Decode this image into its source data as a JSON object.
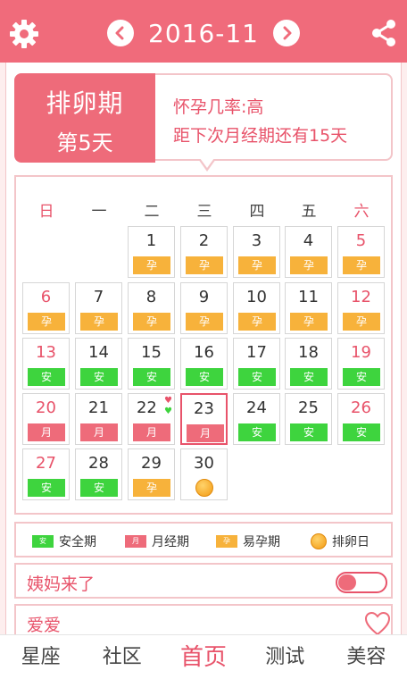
{
  "header": {
    "month": "2016-11",
    "settings_icon": "gear-icon",
    "share_icon": "share-icon",
    "prev_icon": "chevron-left-icon",
    "next_icon": "chevron-right-icon"
  },
  "status": {
    "phase": "排卵期",
    "day": "第5天",
    "pregnancy_rate": "怀孕几率:高",
    "next_period": "距下次月经期还有15天"
  },
  "weekdays": [
    "日",
    "一",
    "二",
    "三",
    "四",
    "五",
    "六"
  ],
  "days": [
    {
      "d": "1",
      "tag": "孕",
      "type": "preg"
    },
    {
      "d": "2",
      "tag": "孕",
      "type": "preg"
    },
    {
      "d": "3",
      "tag": "孕",
      "type": "preg"
    },
    {
      "d": "4",
      "tag": "孕",
      "type": "preg"
    },
    {
      "d": "5",
      "tag": "孕",
      "type": "preg"
    },
    {
      "d": "6",
      "tag": "孕",
      "type": "preg"
    },
    {
      "d": "7",
      "tag": "孕",
      "type": "preg"
    },
    {
      "d": "8",
      "tag": "孕",
      "type": "preg"
    },
    {
      "d": "9",
      "tag": "孕",
      "type": "preg"
    },
    {
      "d": "10",
      "tag": "孕",
      "type": "preg"
    },
    {
      "d": "11",
      "tag": "孕",
      "type": "preg"
    },
    {
      "d": "12",
      "tag": "孕",
      "type": "preg"
    },
    {
      "d": "13",
      "tag": "安",
      "type": "safe"
    },
    {
      "d": "14",
      "tag": "安",
      "type": "safe"
    },
    {
      "d": "15",
      "tag": "安",
      "type": "safe"
    },
    {
      "d": "16",
      "tag": "安",
      "type": "safe"
    },
    {
      "d": "17",
      "tag": "安",
      "type": "safe"
    },
    {
      "d": "18",
      "tag": "安",
      "type": "safe"
    },
    {
      "d": "19",
      "tag": "安",
      "type": "safe"
    },
    {
      "d": "20",
      "tag": "月",
      "type": "period"
    },
    {
      "d": "21",
      "tag": "月",
      "type": "period"
    },
    {
      "d": "22",
      "tag": "月",
      "type": "period"
    },
    {
      "d": "23",
      "tag": "月",
      "type": "period"
    },
    {
      "d": "24",
      "tag": "安",
      "type": "safe"
    },
    {
      "d": "25",
      "tag": "安",
      "type": "safe"
    },
    {
      "d": "26",
      "tag": "安",
      "type": "safe"
    },
    {
      "d": "27",
      "tag": "安",
      "type": "safe"
    },
    {
      "d": "28",
      "tag": "安",
      "type": "safe"
    },
    {
      "d": "29",
      "tag": "孕",
      "type": "preg"
    },
    {
      "d": "30",
      "tag": "",
      "type": "egg"
    }
  ],
  "legend": {
    "safe": "安全期",
    "safe_swatch": "安",
    "period": "月经期",
    "period_swatch": "月",
    "preg": "易孕期",
    "preg_swatch": "孕",
    "ovulation": "排卵日"
  },
  "options": {
    "period_came": "姨妈来了",
    "love": "爱爱"
  },
  "tabs": [
    "星座",
    "社区",
    "首页",
    "测试",
    "美容"
  ],
  "colors": {
    "accent": "#f06b7b",
    "safe": "#3ed43e",
    "preg": "#f7b23b",
    "period": "#ee6b7a"
  }
}
